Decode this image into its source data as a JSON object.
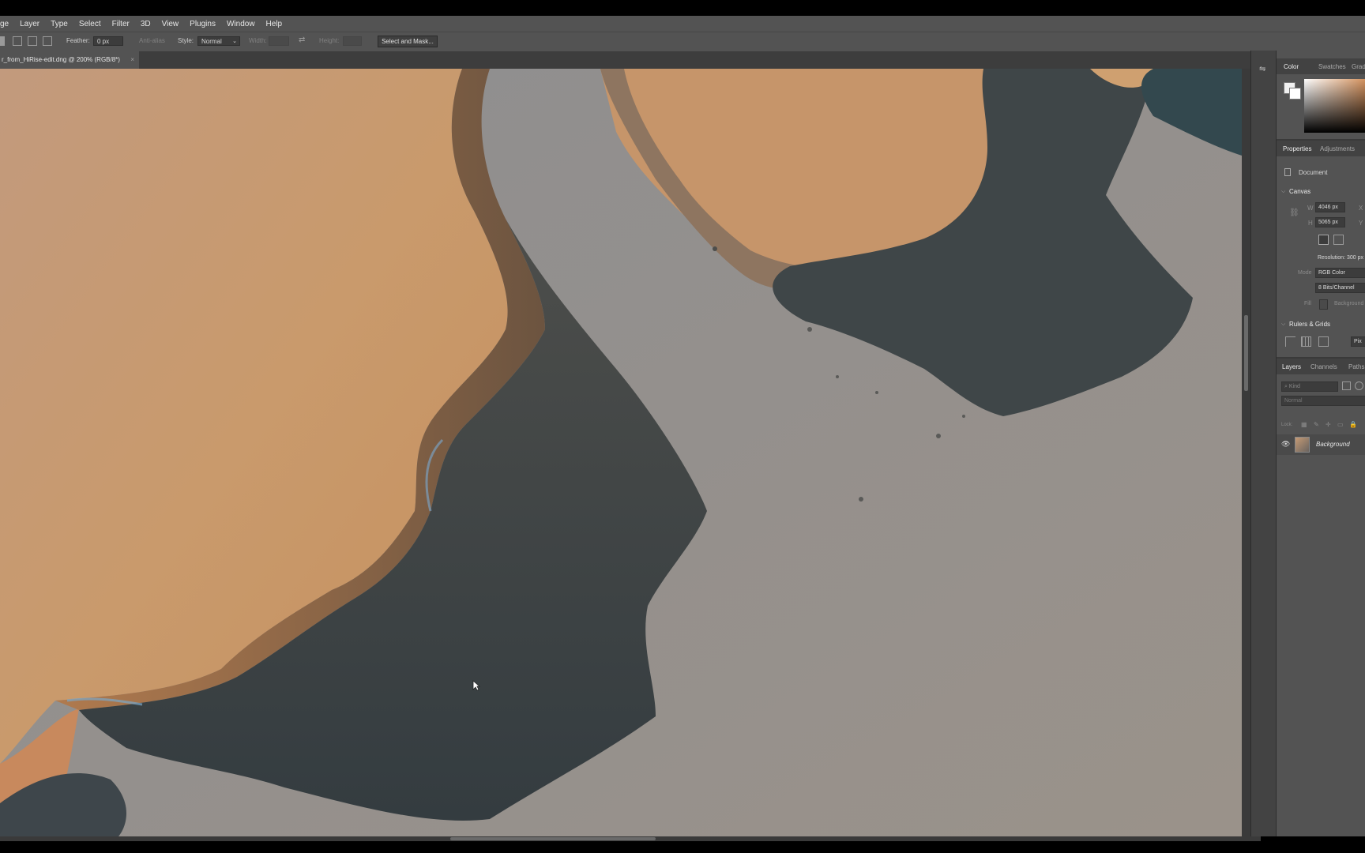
{
  "menu": [
    "ge",
    "Layer",
    "Type",
    "Select",
    "Filter",
    "3D",
    "View",
    "Plugins",
    "Window",
    "Help"
  ],
  "options": {
    "feather_label": "Feather:",
    "feather_value": "0 px",
    "antialias_label": "Anti-alias",
    "style_label": "Style:",
    "style_value": "Normal",
    "width_label": "Width:",
    "height_label": "Height:",
    "select_mask": "Select and Mask..."
  },
  "document_tab": {
    "title": "r_from_HiRise-edit.dng @ 200% (RGB/8*)",
    "close": "×"
  },
  "status": "",
  "panels": {
    "color_tabs": [
      "Color",
      "Swatches",
      "Gradien"
    ],
    "properties_tabs": [
      "Properties",
      "Adjustments"
    ],
    "document_label": "Document",
    "canvas_section": "Canvas",
    "w_label": "W",
    "w_value": "4046 px",
    "x_label": "X",
    "h_label": "H",
    "h_value": "5065 px",
    "y_label": "Y",
    "resolution": "Resolution: 300 px",
    "mode_label": "Mode",
    "mode_value": "RGB Color",
    "bits_value": "8 Bits/Channel",
    "fill_label": "Fill",
    "fill_value": "Background",
    "rulers_section": "Rulers & Grids",
    "rulers_value": "Pix",
    "layers_tabs": [
      "Layers",
      "Channels",
      "Paths"
    ],
    "kind_placeholder": "Kind",
    "blend_mode": "Normal",
    "lock_label": "Lock:",
    "layer_name": "Background"
  },
  "colors": {
    "ui_bg": "#535353",
    "ui_dark": "#3d3d3d",
    "image_sand": "#c59a74",
    "image_shadow": "#3b4347",
    "image_floor": "#8f8c88"
  }
}
